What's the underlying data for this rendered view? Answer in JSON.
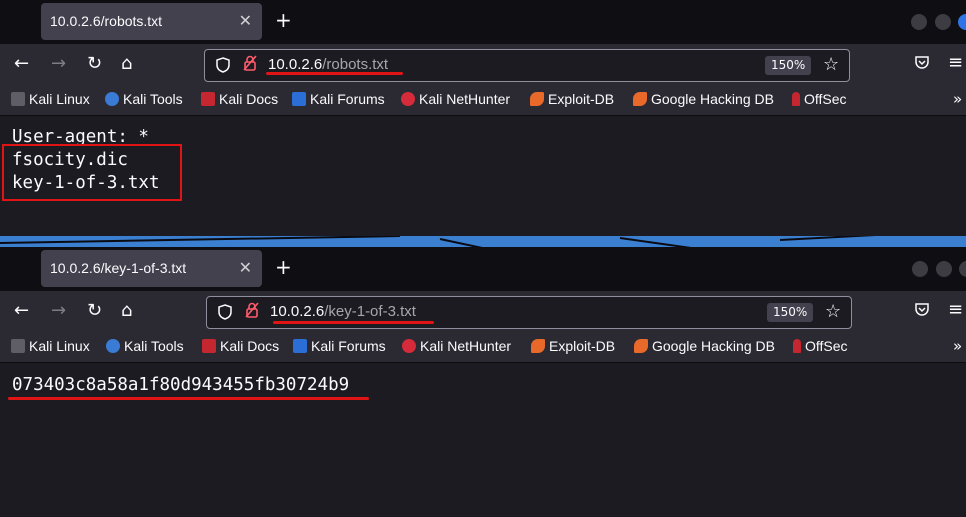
{
  "windows": [
    {
      "tab_title": "10.0.2.6/robots.txt",
      "url_host": "10.0.2.6",
      "url_path": "/robots.txt",
      "zoom": "150%",
      "content_lines": [
        "User-agent: *",
        "fsocity.dic",
        "key-1-of-3.txt"
      ]
    },
    {
      "tab_title": "10.0.2.6/key-1-of-3.txt",
      "url_host": "10.0.2.6",
      "url_path": "/key-1-of-3.txt",
      "zoom": "150%",
      "content_lines": [
        "073403c8a58a1f80d943455fb30724b9"
      ]
    }
  ],
  "bookmarks": [
    {
      "label": "Kali Linux",
      "icon": "kali-dragon-icon"
    },
    {
      "label": "Kali Tools",
      "icon": "kali-tools-icon"
    },
    {
      "label": "Kali Docs",
      "icon": "kali-docs-icon"
    },
    {
      "label": "Kali Forums",
      "icon": "kali-forums-icon"
    },
    {
      "label": "Kali NetHunter",
      "icon": "nethunter-icon"
    },
    {
      "label": "Exploit-DB",
      "icon": "exploit-db-icon"
    },
    {
      "label": "Google Hacking DB",
      "icon": "ghdb-icon"
    },
    {
      "label": "OffSec",
      "icon": "offsec-icon"
    }
  ],
  "icons": {
    "new_tab": "+",
    "close_tab": "✕",
    "back": "←",
    "forward": "→",
    "reload": "↻",
    "home": "⌂",
    "star": "☆",
    "menu": "≡",
    "more": "»"
  },
  "colors": {
    "annotation_red": "#e01414",
    "url_lock_red": "#ff5b6b",
    "window_bg": "#1c1b22"
  }
}
